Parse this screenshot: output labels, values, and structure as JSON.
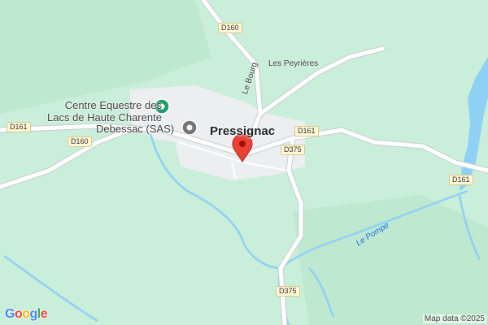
{
  "map": {
    "town": "Pressignac",
    "localities": {
      "les_peyrieres": "Les Peyrières",
      "le_bourg": "Le Bourg",
      "le_pompe": "Le Pompe"
    },
    "roads": {
      "d160_top": "D160",
      "d160_left": "D160",
      "d161_left": "D161",
      "d161_center": "D161",
      "d161_right": "D161",
      "d375_center": "D375",
      "d375_bottom": "D375"
    },
    "pois": [
      {
        "name": "Centre Equestre des Lacs de Haute Charente",
        "line1": "Centre Equestre des",
        "line2": "Lacs de Haute Charente",
        "icon": "horse-pin-icon",
        "color": "#1e9e6a"
      },
      {
        "name": "Debessac (SAS)",
        "icon": "place-pin-icon",
        "color": "#757575"
      }
    ],
    "marker": {
      "icon": "red-location-marker-icon",
      "color": "#ea4335"
    },
    "logo": "Google",
    "attribution": "Map data ©2025"
  },
  "colors": {
    "land": "#c9eed9",
    "water": "#8ed1f5",
    "urban": "#eceef0",
    "road": "#ffffff",
    "road_outline": "#c8cdd1"
  }
}
